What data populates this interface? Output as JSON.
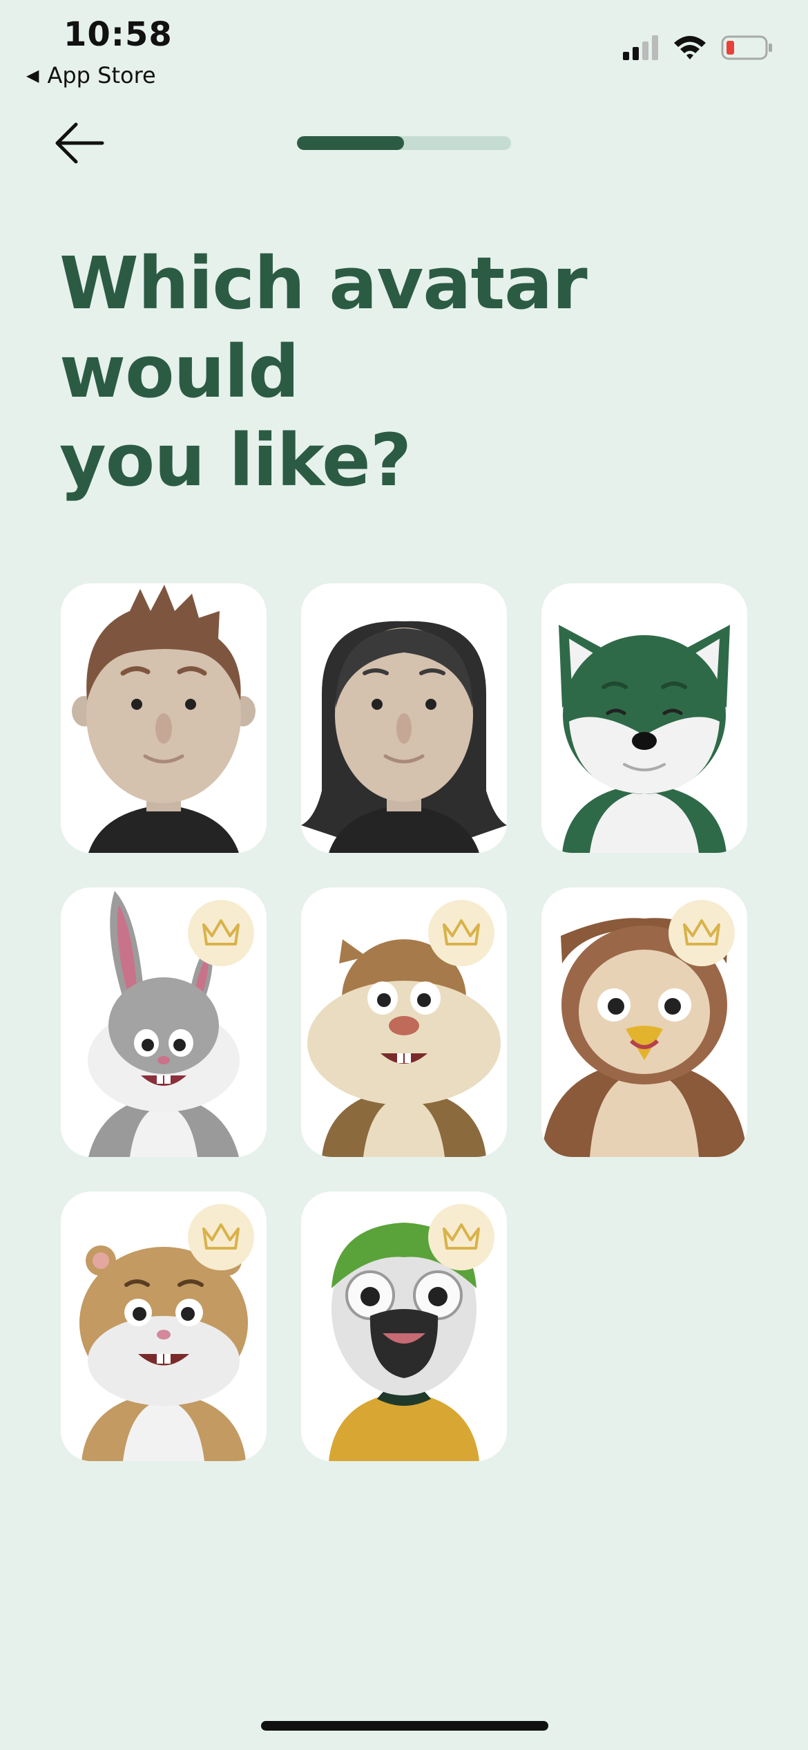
{
  "status_bar": {
    "time": "10:58",
    "back_app": "App Store",
    "icons": [
      "cellular-signal-icon",
      "wifi-icon",
      "battery-low-icon"
    ]
  },
  "nav": {
    "back_icon": "arrow-left-icon",
    "progress_fraction": 0.5
  },
  "title": {
    "line1": "Which avatar would",
    "line2": "you like?"
  },
  "colors": {
    "background": "#e6f1ec",
    "accent": "#2c5b43",
    "progress_track": "#c5dcd2",
    "card": "#ffffff",
    "crown_badge": "#f7ecd0",
    "crown": "#d9b24a"
  },
  "avatars": [
    {
      "id": "boy",
      "premium": false
    },
    {
      "id": "girl",
      "premium": false
    },
    {
      "id": "fox",
      "premium": false
    },
    {
      "id": "rabbit",
      "premium": true
    },
    {
      "id": "chipmunk",
      "premium": true
    },
    {
      "id": "owl",
      "premium": true
    },
    {
      "id": "hamster",
      "premium": true
    },
    {
      "id": "parrot",
      "premium": true
    }
  ]
}
